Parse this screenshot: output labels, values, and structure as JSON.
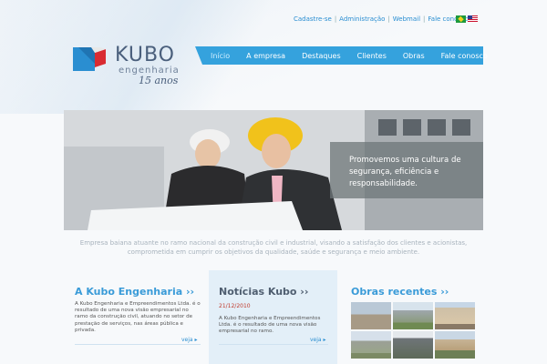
{
  "top_links": {
    "register": "Cadastre-se",
    "admin": "Administração",
    "webmail": "Webmail",
    "contact": "Fale conosco",
    "separator": "|"
  },
  "flags": [
    "brazil-flag-icon",
    "usa-flag-icon"
  ],
  "logo": {
    "word": "KUBO",
    "sub": "engenharia",
    "years": "15 anos",
    "colors": {
      "blue": "#2a8ed1",
      "red": "#d92b32",
      "text": "#4a5f7c"
    }
  },
  "nav": {
    "items": [
      "Início",
      "A empresa",
      "Destaques",
      "Clientes",
      "Obras",
      "Fale conosco"
    ],
    "active_index": 0,
    "color": "#35a2dd"
  },
  "hero": {
    "caption": "Promovemos uma cultura de segurança, eficiência e responsabilidade."
  },
  "tagline": "Empresa baiana atuante no ramo nacional da construção civil e industrial, visando a satisfação dos clientes e acionistas, comprometida em cumprir os objetivos da qualidade, saúde e segurança e meio ambiente.",
  "columns": {
    "about": {
      "title": "A Kubo Engenharia ››",
      "text": "A Kubo Engenharia e Empreendimentos Ltda. é o resultado de uma nova visão empresarial no ramo da construção civil, atuando no setor de prestação de serviços, nas áreas pública e privada.",
      "more": "veja"
    },
    "news": {
      "title": "Notícias Kubo ››",
      "date": "21/12/2010",
      "text": "A Kubo Engenharia e Empreendimentos Ltda. é o resultado de uma nova visão empresarial no ramo.",
      "more": "veja"
    },
    "works": {
      "title": "Obras recentes ››"
    }
  }
}
